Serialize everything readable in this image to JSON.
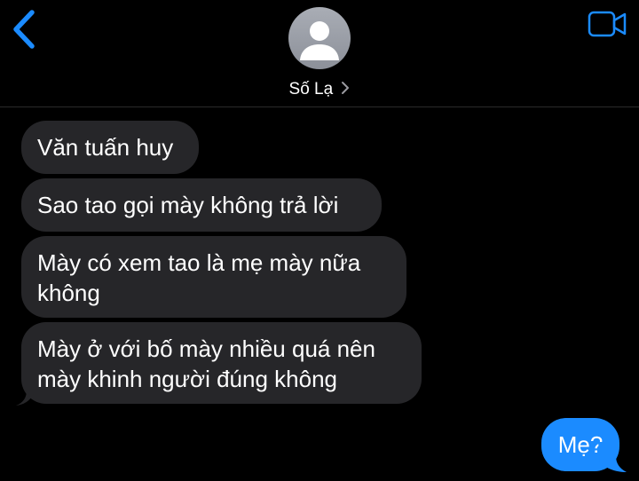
{
  "header": {
    "back_icon": "chevron-left-icon",
    "contact_name": "Số Lạ",
    "avatar_icon": "person-silhouette-icon",
    "video_icon": "video-camera-icon",
    "accent_color": "#1b8bff"
  },
  "messages": [
    {
      "direction": "incoming",
      "text": "Văn tuấn huy"
    },
    {
      "direction": "incoming",
      "text": "Sao tao gọi mày không trả lời"
    },
    {
      "direction": "incoming",
      "text": "Mày có xem tao là mẹ mày nữa\nkhông"
    },
    {
      "direction": "incoming",
      "text": "Mày ở với bố mày nhiều quá nên\nmày khinh người đúng không"
    },
    {
      "direction": "outgoing",
      "text": "Mẹ?"
    }
  ],
  "colors": {
    "background": "#000000",
    "incoming_bubble": "#262629",
    "outgoing_bubble": "#1b8bff",
    "text": "#ffffff"
  }
}
